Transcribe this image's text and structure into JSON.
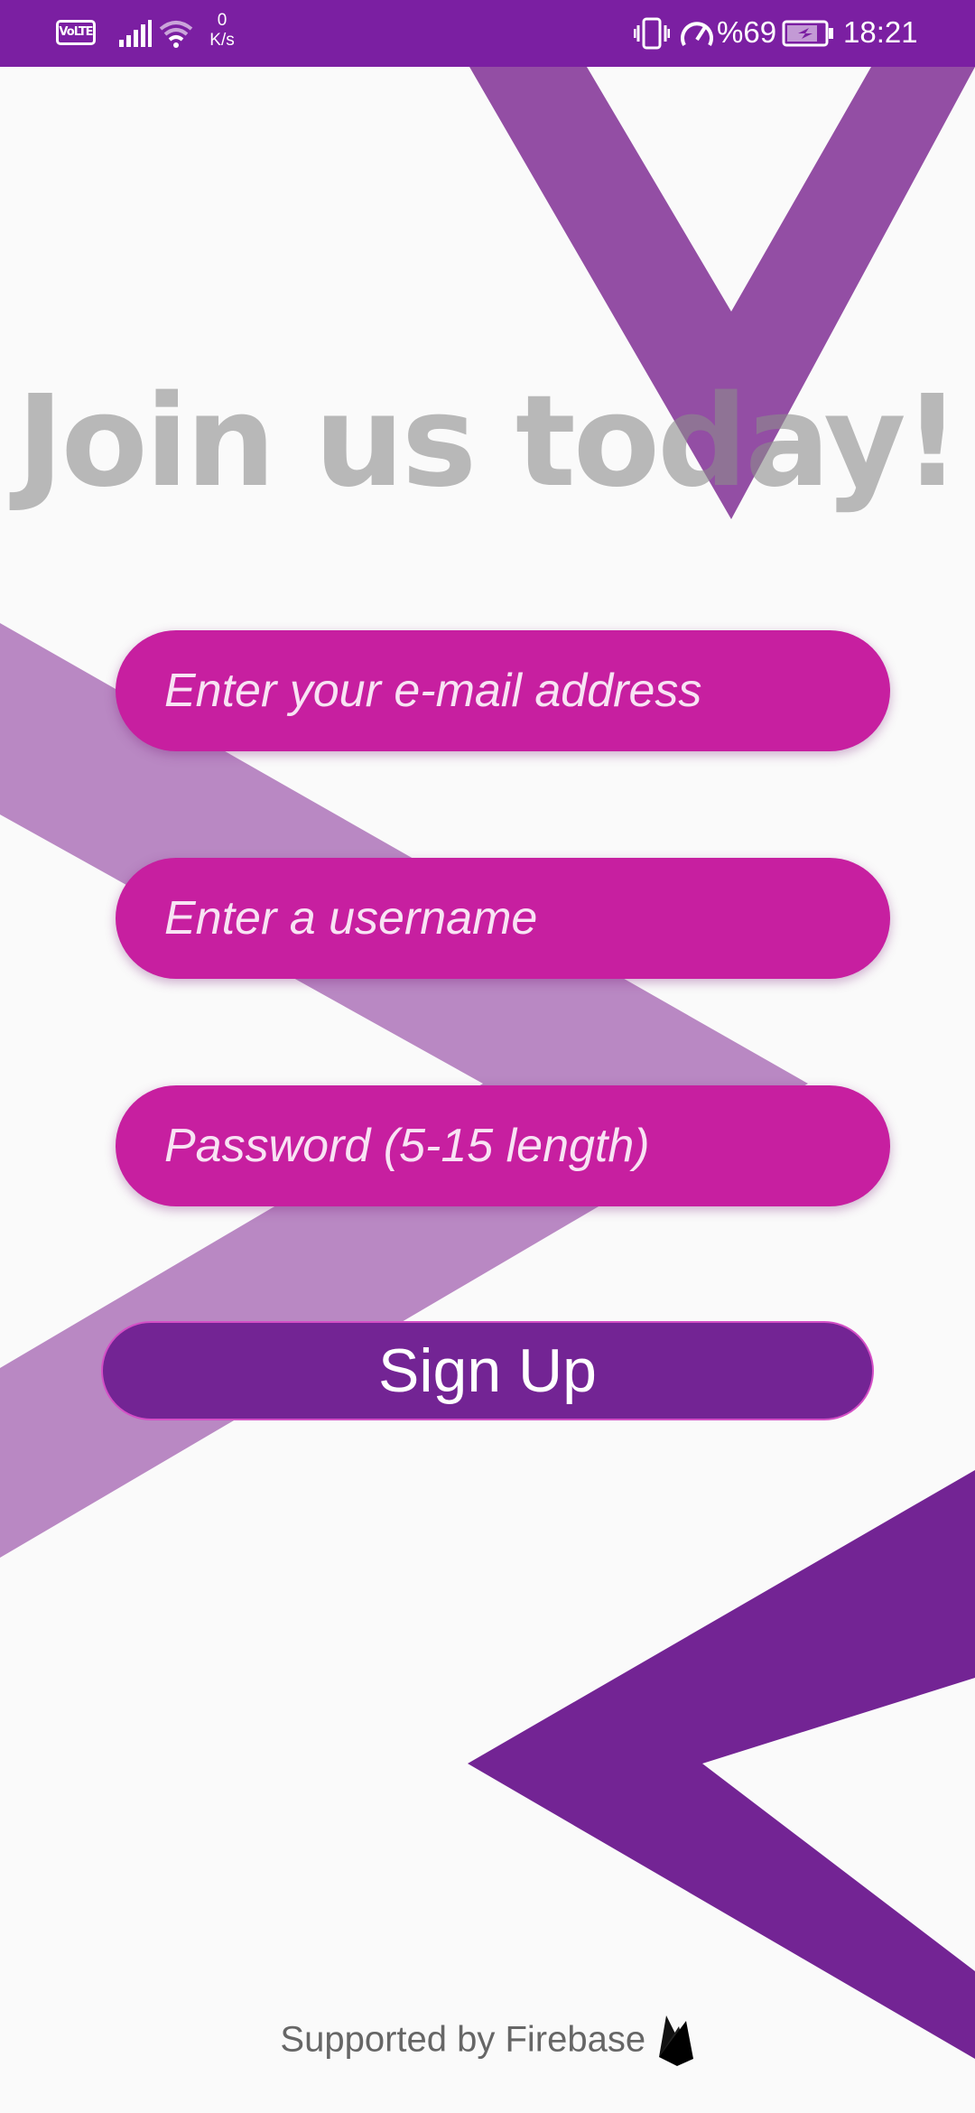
{
  "status_bar": {
    "volte": "VoLTE",
    "net_speed_value": "0",
    "net_speed_unit": "K/s",
    "battery_percent": "%69",
    "time": "18:21",
    "icons": [
      "volte-icon",
      "signal-icon",
      "wifi-icon",
      "vibrate-icon",
      "speedometer-icon",
      "battery-charging-icon"
    ]
  },
  "title": "Join us today!",
  "form": {
    "email_placeholder": "Enter your e-mail address",
    "username_placeholder": "Enter a username",
    "password_placeholder": "Password (5-15 length)",
    "signup_label": "Sign Up"
  },
  "footer": {
    "text": "Supported by Firebase",
    "icon": "firebase-icon"
  },
  "colors": {
    "status_bar": "#7b1fa2",
    "field": "#c71fa0",
    "button": "#732494",
    "chevron": "#7b2496",
    "background": "#fafafa"
  }
}
